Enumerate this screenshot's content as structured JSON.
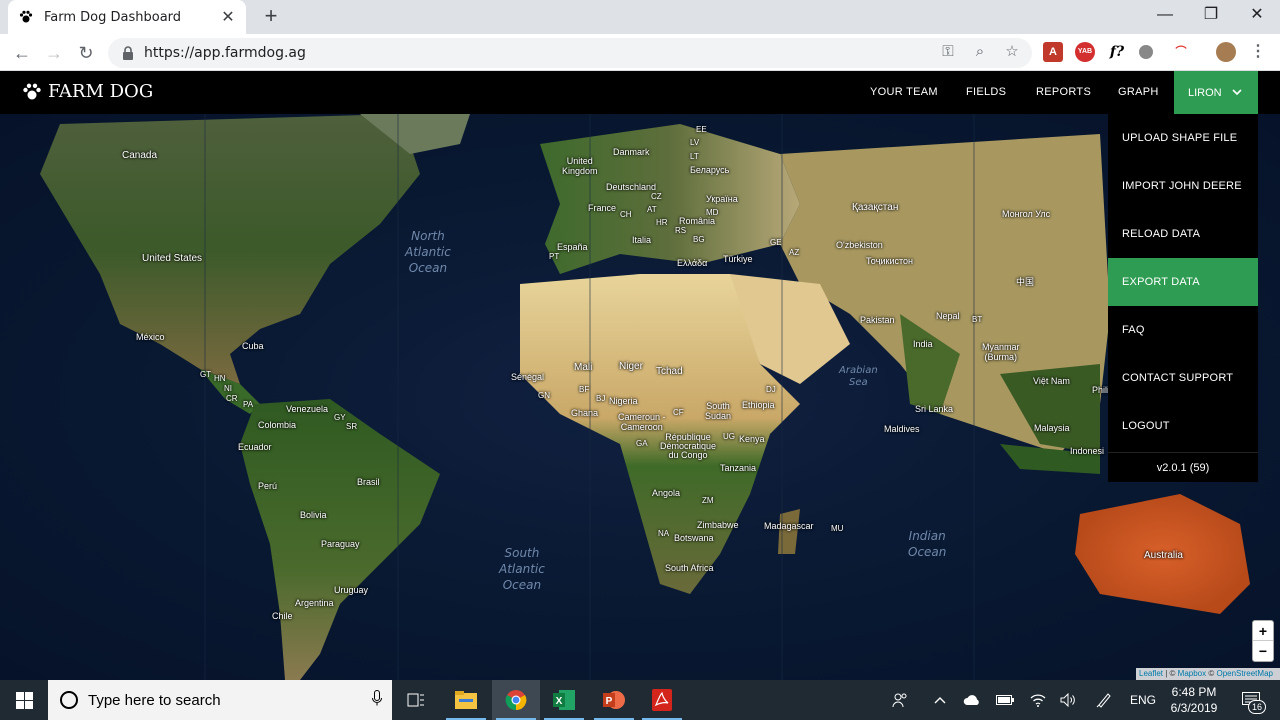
{
  "browser": {
    "tab_title": "Farm Dog Dashboard",
    "url": "https://app.farmdog.ag"
  },
  "app": {
    "logo_text": "FARM DOG",
    "nav": [
      "YOUR TEAM",
      "FIELDS",
      "REPORTS",
      "GRAPH"
    ],
    "user": "LIRON"
  },
  "dropdown": {
    "items": [
      {
        "label": "UPLOAD SHAPE FILE"
      },
      {
        "label": "IMPORT JOHN DEERE"
      },
      {
        "label": "RELOAD DATA"
      },
      {
        "label": "EXPORT DATA",
        "active": true
      },
      {
        "label": "FAQ"
      },
      {
        "label": "CONTACT SUPPORT"
      },
      {
        "label": "LOGOUT"
      }
    ],
    "version": "v2.0.1 (59)"
  },
  "map": {
    "labels": {
      "canada": "Canada",
      "united_states": "United States",
      "mexico": "México",
      "cuba": "Cuba",
      "gt": "GT",
      "hn": "HN",
      "ni": "NI",
      "cr": "CR",
      "pa": "PA",
      "venezuela": "Venezuela",
      "gy": "GY",
      "sr": "SR",
      "colombia": "Colombia",
      "ecuador": "Ecuador",
      "peru": "Perú",
      "brasil": "Brasil",
      "bolivia": "Bolivia",
      "paraguay": "Paraguay",
      "uruguay": "Uruguay",
      "argentina": "Argentina",
      "chile": "Chile",
      "uk": "United\nKingdom",
      "danmark": "Danmark",
      "deutschland": "Deutschland",
      "france": "France",
      "espana": "España",
      "pt": "PT",
      "italia": "Italia",
      "ch": "CH",
      "at": "AT",
      "cz": "CZ",
      "hr": "HR",
      "rs": "RS",
      "bg": "BG",
      "romania": "România",
      "md": "MD",
      "ellada": "Ελλάδα",
      "ee": "EE",
      "lv": "LV",
      "lt": "LT",
      "belarus": "Беларусь",
      "ukraine": "Україна",
      "turkiye": "Türkiye",
      "ge": "GE",
      "az": "AZ",
      "kazakhstan": "Қазақстан",
      "uzbekiston": "O'zbekiston",
      "tajikistan": "Тоҷикистон",
      "mongolia": "Монгол Улс",
      "china": "中国",
      "pakistan": "Pakistan",
      "india": "India",
      "nepal": "Nepal",
      "bt": "BT",
      "myanmar": "Myanmar\n(Burma)",
      "vietnam": "Việt Nam",
      "sri_lanka": "Sri Lanka",
      "maldives": "Maldives",
      "malaysia": "Malaysia",
      "indonesia": "Indonesi",
      "philippines": "Phili",
      "australia": "Australia",
      "senegal": "Sénégal",
      "mali": "Mali",
      "niger": "Niger",
      "tchad": "Tchad",
      "gn": "GN",
      "bf": "BF",
      "bj": "BJ",
      "ghana": "Ghana",
      "nigeria": "Nigeria",
      "cameroun": "Cameroun -\nCameroon",
      "cf": "CF",
      "south_sudan": "South\nSudan",
      "ethiopia": "Ethiopia",
      "ga": "GA",
      "rdc": "République\nDémocratique\ndu Congo",
      "ug": "UG",
      "kenya": "Kenya",
      "tanzania": "Tanzania",
      "angola": "Angola",
      "zm": "ZM",
      "zimbabwe": "Zimbabwe",
      "na": "NA",
      "botswana": "Botswana",
      "south_africa": "South Africa",
      "madagascar": "Madagascar",
      "mu": "MU",
      "dj": "DJ"
    },
    "oceans": {
      "north_atlantic": "North\nAtlantic\nOcean",
      "south_atlantic": "South\nAtlantic\nOcean",
      "indian": "Indian\nOcean",
      "arabian_sea": "Arabian\nSea"
    },
    "attribution": {
      "leaflet": "Leaflet",
      "sep": " | © ",
      "mapbox": "Mapbox",
      "sep2": " © ",
      "osm": "OpenStreetMap"
    },
    "zoom_in": "+",
    "zoom_out": "−"
  },
  "taskbar": {
    "search_placeholder": "Type here to search",
    "lang": "ENG",
    "time": "6:48 PM",
    "date": "6/3/2019",
    "notif_count": "16"
  },
  "colors": {
    "accent_green": "#2e9c52",
    "ocean": "#0a1a35",
    "land_green": "#3a5a2a",
    "desert": "#d8c38a"
  }
}
